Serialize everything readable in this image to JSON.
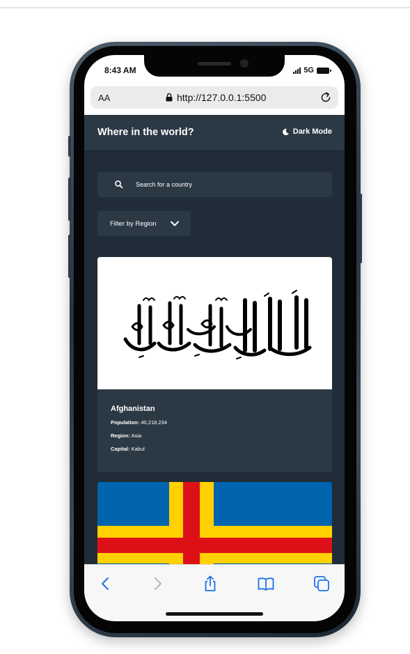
{
  "status_bar": {
    "time": "8:43 AM",
    "network": "5G"
  },
  "browser": {
    "text_size_label": "AA",
    "url": "http://127.0.0.1:5500"
  },
  "app": {
    "title": "Where in the world?",
    "dark_mode_label": "Dark Mode",
    "search": {
      "placeholder": "Search for a country"
    },
    "filter": {
      "label": "Filter by Region"
    },
    "countries": [
      {
        "name": "Afghanistan",
        "population_label": "Population:",
        "population": "40,218,234",
        "region_label": "Region:",
        "region": "Asia",
        "capital_label": "Capital:",
        "capital": "Kabul",
        "flag_icon": "afghanistan-flag"
      },
      {
        "flag_icon": "aland-islands-flag"
      }
    ]
  },
  "toolbar": {
    "icons": [
      "back-icon",
      "forward-icon",
      "share-icon",
      "bookmarks-icon",
      "tabs-icon"
    ]
  },
  "colors": {
    "background": "#202c37",
    "element": "#2b3945",
    "text": "#ffffff",
    "aland_blue": "#0064ae",
    "aland_yellow": "#ffd100",
    "aland_red": "#de1017"
  }
}
